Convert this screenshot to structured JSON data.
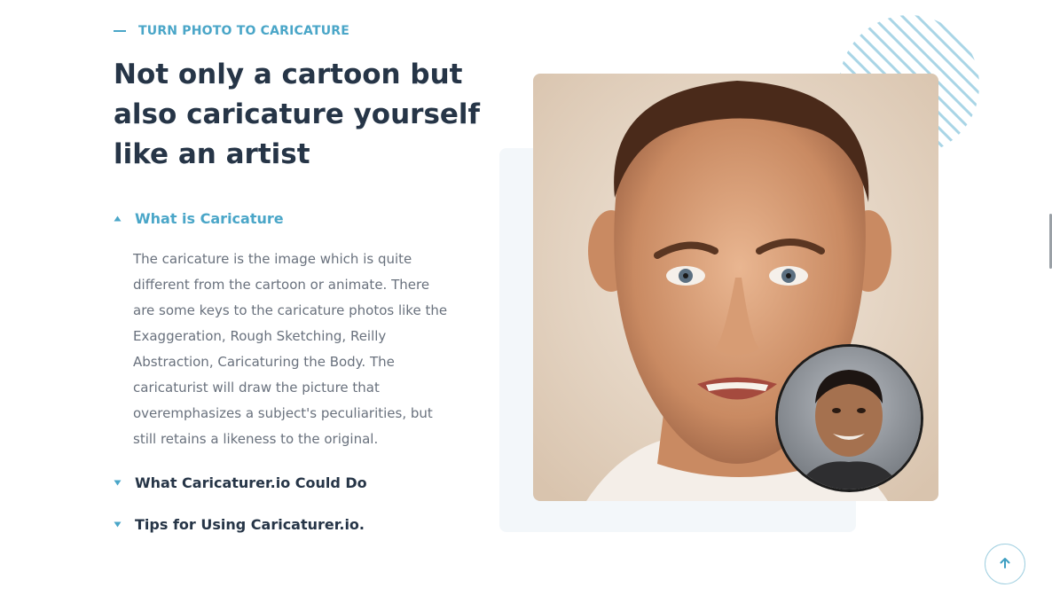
{
  "section": {
    "eyebrow": "TURN PHOTO TO CARICATURE",
    "headline": "Not only a cartoon but also caricature yourself like an artist"
  },
  "faq": {
    "items": [
      {
        "title": "What is Caricature",
        "expanded": true,
        "body": "The caricature is the image which is quite different from the cartoon or animate. There are some keys to the caricature photos like the Exaggeration, Rough Sketching, Reilly Abstraction, Caricaturing the Body. The caricaturist will draw the picture that overemphasizes a subject's peculiarities, but still retains a likeness to the original."
      },
      {
        "title": "What Caricaturer.io Could Do",
        "expanded": false
      },
      {
        "title": "Tips for Using Caricaturer.io.",
        "expanded": false
      }
    ]
  },
  "icons": {
    "expanded_arrow": "caret-up-icon",
    "collapsed_arrow": "caret-down-icon",
    "back_to_top": "arrow-up-icon"
  },
  "colors": {
    "accent": "#4aa6c8",
    "heading": "#263547",
    "body_text": "#69717d",
    "panel_bg": "#f3f7fa"
  }
}
